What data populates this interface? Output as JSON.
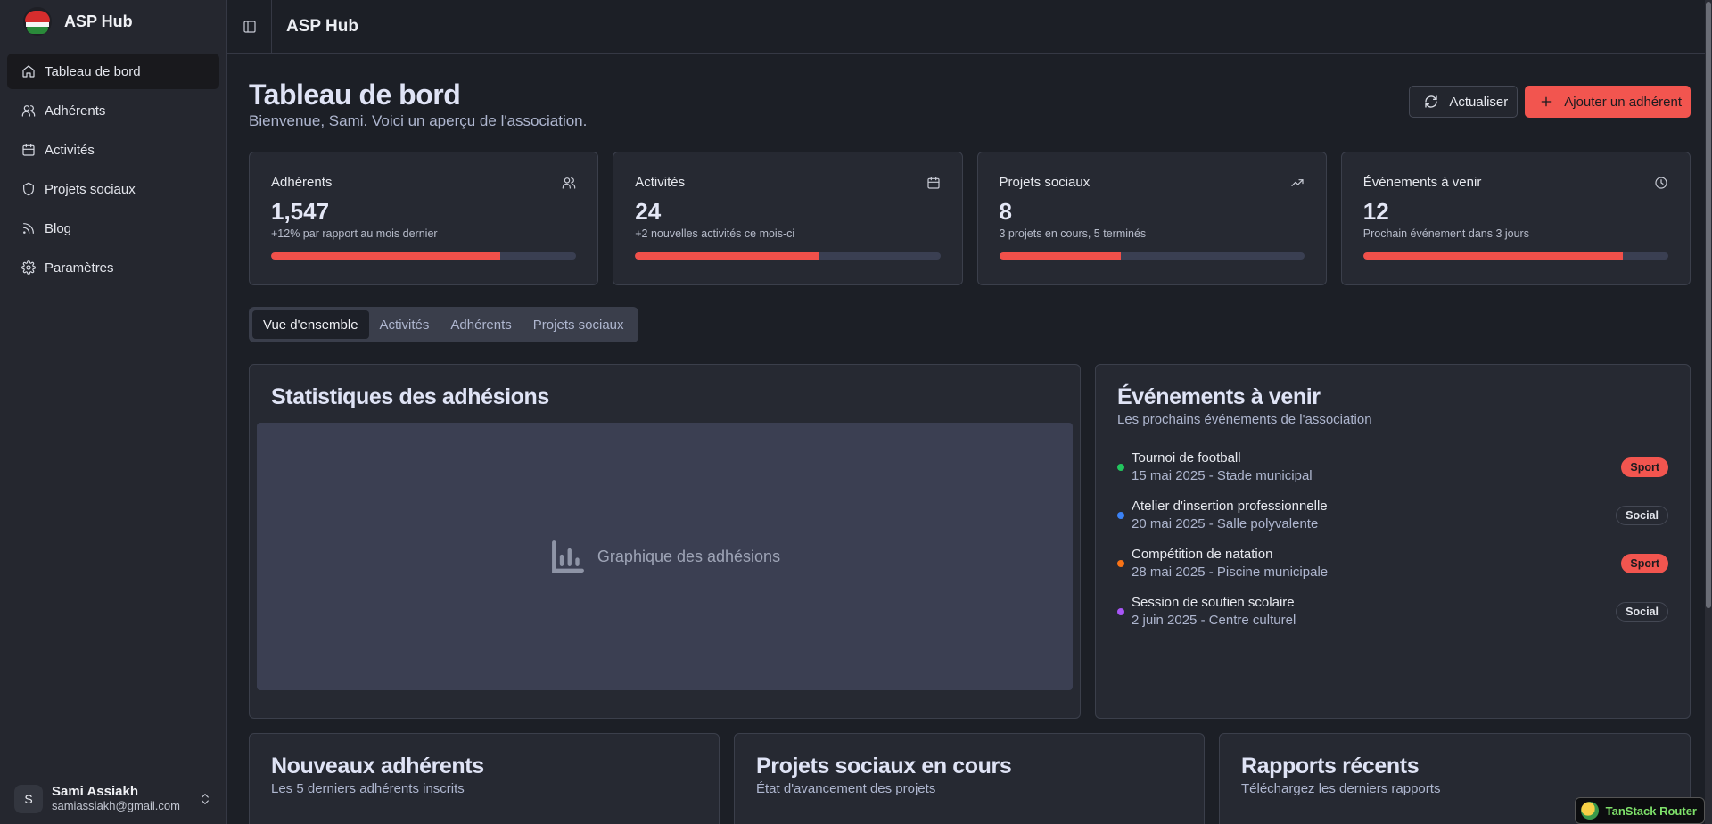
{
  "brand": {
    "name": "ASP Hub"
  },
  "sidebar": {
    "items": [
      {
        "label": "Tableau de bord",
        "icon": "home-icon",
        "active": true
      },
      {
        "label": "Adhérents",
        "icon": "users-icon"
      },
      {
        "label": "Activités",
        "icon": "calendar-icon"
      },
      {
        "label": "Projets sociaux",
        "icon": "shield-icon"
      },
      {
        "label": "Blog",
        "icon": "rss-icon"
      },
      {
        "label": "Paramètres",
        "icon": "gear-icon"
      }
    ]
  },
  "user": {
    "initial": "S",
    "name": "Sami Assiakh",
    "email": "samiassiakh@gmail.com"
  },
  "topbar": {
    "title": "ASP Hub"
  },
  "page": {
    "title": "Tableau de bord",
    "subtitle": "Bienvenue, Sami. Voici un aperçu de l'association.",
    "refresh_label": "Actualiser",
    "add_label": "Ajouter un adhérent"
  },
  "stats": [
    {
      "label": "Adhérents",
      "value": "1,547",
      "note": "+12% par rapport au mois dernier",
      "icon": "users-icon",
      "progress": 0.75
    },
    {
      "label": "Activités",
      "value": "24",
      "note": "+2 nouvelles activités ce mois-ci",
      "icon": "calendar-icon",
      "progress": 0.6
    },
    {
      "label": "Projets sociaux",
      "value": "8",
      "note": "3 projets en cours, 5 terminés",
      "icon": "trending-up-icon",
      "progress": 0.4
    },
    {
      "label": "Événements à venir",
      "value": "12",
      "note": "Prochain événement dans 3 jours",
      "icon": "clock-icon",
      "progress": 0.85
    }
  ],
  "tabs": [
    "Vue d'ensemble",
    "Activités",
    "Adhérents",
    "Projets sociaux"
  ],
  "chart_card": {
    "title": "Statistiques des adhésions",
    "placeholder": "Graphique des adhésions"
  },
  "events_card": {
    "title": "Événements à venir",
    "subtitle": "Les prochains événements de l'association",
    "items": [
      {
        "name": "Tournoi de football",
        "meta": "15 mai 2025 - Stade municipal",
        "badge": "Sport",
        "dot": "#22c55e"
      },
      {
        "name": "Atelier d'insertion professionnelle",
        "meta": "20 mai 2025 - Salle polyvalente",
        "badge": "Social",
        "dot": "#3b82f6"
      },
      {
        "name": "Compétition de natation",
        "meta": "28 mai 2025 - Piscine municipale",
        "badge": "Sport",
        "dot": "#f97316"
      },
      {
        "name": "Session de soutien scolaire",
        "meta": "2 juin 2025 - Centre culturel",
        "badge": "Social",
        "dot": "#a855f7"
      }
    ]
  },
  "bottom_cards": [
    {
      "title": "Nouveaux adhérents",
      "subtitle": "Les 5 derniers adhérents inscrits"
    },
    {
      "title": "Projets sociaux en cours",
      "subtitle": "État d'avancement des projets"
    },
    {
      "title": "Rapports récents",
      "subtitle": "Téléchargez les derniers rapports"
    }
  ],
  "devtools": {
    "label": "TanStack Router"
  },
  "colors": {
    "accent": "#f2554f",
    "background": "#1c1f26",
    "card": "#262932"
  }
}
